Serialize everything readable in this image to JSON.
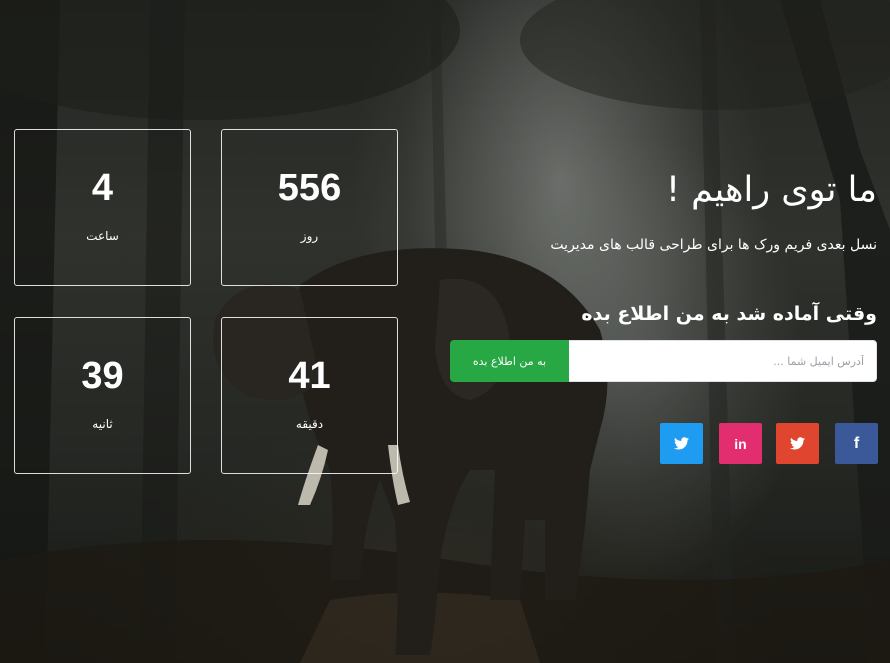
{
  "hero": {
    "title": "ما توی راهیم !",
    "subtitle": "نسل بعدی فریم ورک ها برای طراحی قالب های مدیریت"
  },
  "countdown": {
    "days": {
      "value": "556",
      "label": "روز"
    },
    "hours": {
      "value": "4",
      "label": "ساعت"
    },
    "minutes": {
      "value": "41",
      "label": "دقیقه"
    },
    "seconds": {
      "value": "39",
      "label": "ثانیه"
    }
  },
  "notify": {
    "heading": "وقتی آماده شد به من اطلاع بده",
    "email_placeholder": "آدرس ایمیل شما ...",
    "email_value": "",
    "button_label": "به من اطلاع بده"
  },
  "social": [
    {
      "name": "facebook",
      "icon": "facebook-icon",
      "color": "#3b5998"
    },
    {
      "name": "twitter",
      "icon": "twitter-icon",
      "color": "#e0452f"
    },
    {
      "name": "linkedin",
      "icon": "linkedin-icon",
      "color": "#e22d6f"
    },
    {
      "name": "twitter",
      "icon": "twitter-icon",
      "color": "#1e9cf1"
    }
  ],
  "colors": {
    "accent_green": "#28a745"
  }
}
